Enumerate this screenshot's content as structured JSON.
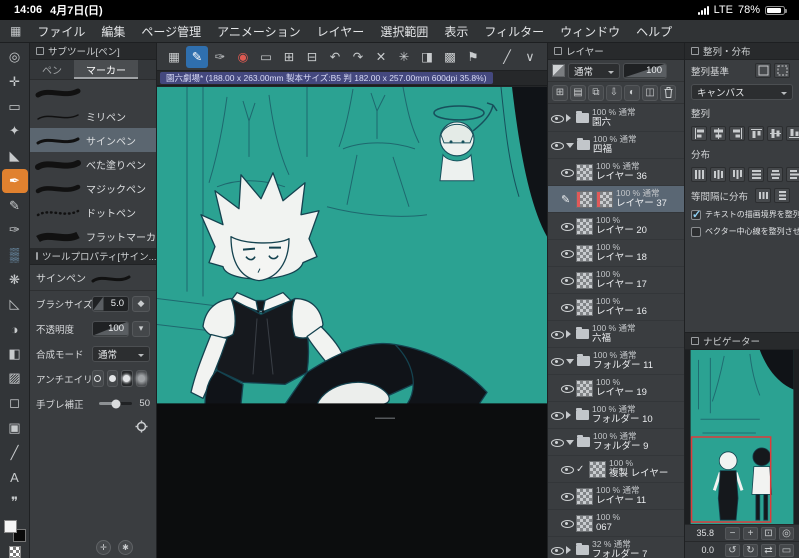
{
  "status_bar": {
    "time": "14:06",
    "date": "4月7日(日)",
    "network": "LTE",
    "battery_percent": "78%"
  },
  "menu_bar": {
    "items": [
      "ファイル",
      "編集",
      "ページ管理",
      "アニメーション",
      "レイヤー",
      "選択範囲",
      "表示",
      "フィルター",
      "ウィンドウ",
      "ヘルプ"
    ]
  },
  "document": {
    "tab_title": "園六劇場* (188.00 x 263.00mm 製本サイズ:B5 判 182.00 x 257.00mm 600dpi 35.8%)"
  },
  "subtool_panel": {
    "title": "サブツール[ペン]",
    "tabs": [
      "ペン",
      "マーカー"
    ],
    "items": [
      "",
      "ミリペン",
      "サインペン",
      "べた塗りペン",
      "マジックペン",
      "ドットペン",
      "フラットマーカー"
    ]
  },
  "tool_property": {
    "title": "ツールプロパティ[サイン...",
    "tool_name": "サインペン",
    "brush_size_label": "ブラシサイズ",
    "brush_size_value": "5.0",
    "opacity_label": "不透明度",
    "opacity_value": "100",
    "blend_label": "合成モード",
    "blend_value": "通常",
    "antialias_label": "アンチエイリアス",
    "stabilize_label": "手ブレ補正",
    "stabilize_value": "50"
  },
  "layers_panel": {
    "title": "レイヤー",
    "blend_mode": "通常",
    "opacity_value": "100",
    "layers": [
      {
        "percent": "100 %",
        "mode": "通常",
        "name": "園六"
      },
      {
        "percent": "100 %",
        "mode": "通常",
        "name": "四福"
      },
      {
        "percent": "100 %",
        "mode": "通常",
        "name": "レイヤー 36"
      },
      {
        "percent": "100 %",
        "mode": "通常",
        "name": "レイヤー 37"
      },
      {
        "percent": "100 %",
        "mode": "",
        "name": "レイヤー 20"
      },
      {
        "percent": "100 %",
        "mode": "",
        "name": "レイヤー 18"
      },
      {
        "percent": "100 %",
        "mode": "",
        "name": "レイヤー 17"
      },
      {
        "percent": "100 %",
        "mode": "",
        "name": "レイヤー 16"
      },
      {
        "percent": "100 %",
        "mode": "通常",
        "name": "六福"
      },
      {
        "percent": "100 %",
        "mode": "通常",
        "name": "フォルダー 11"
      },
      {
        "percent": "100 %",
        "mode": "",
        "name": "レイヤー 19"
      },
      {
        "percent": "100 %",
        "mode": "通常",
        "name": "フォルダー 10"
      },
      {
        "percent": "100 %",
        "mode": "通常",
        "name": "フォルダー 9"
      },
      {
        "percent": "100 %",
        "mode": "",
        "name": "複製 レイヤー"
      },
      {
        "percent": "100 %",
        "mode": "通常",
        "name": "レイヤー 11"
      },
      {
        "percent": "100 %",
        "mode": "",
        "name": "067"
      },
      {
        "percent": "32 %",
        "mode": "通常",
        "name": "フォルダー 7"
      }
    ]
  },
  "align_panel": {
    "title": "整列・分布",
    "basis_label": "整列基準",
    "basis_value": "キャンバス",
    "align_label": "整列",
    "distribute_label": "分布",
    "equal_label": "等間隔に分布",
    "checkbox_text": "テキストの描画境界を整列させる",
    "checkbox_vector": "ベクター中心線を整列させる"
  },
  "navigator": {
    "title": "ナビゲーター",
    "zoom_value": "35.8",
    "rotate_value": "0.0"
  },
  "colors": {
    "accent_orange": "#e0812f",
    "accent_blue": "#2f6fae",
    "canvas_teal": "#2ba292",
    "selection_red": "#e03a3a"
  }
}
